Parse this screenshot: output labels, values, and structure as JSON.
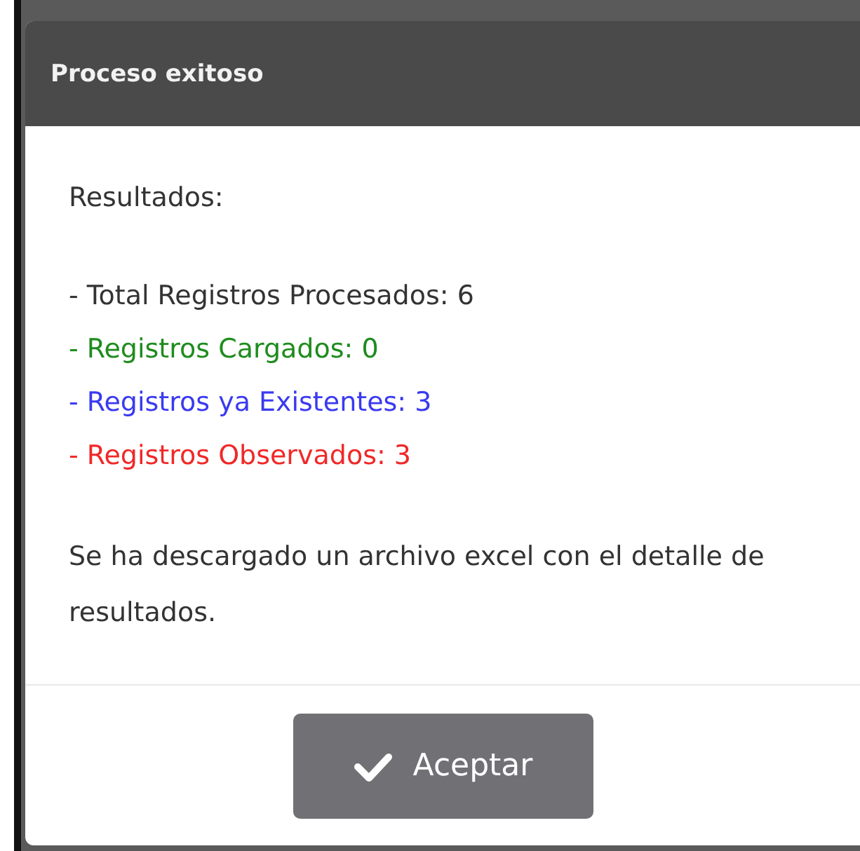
{
  "dialog": {
    "title": "Proceso exitoso",
    "heading": "Resultados:",
    "results": [
      {
        "text": "- Total Registros Procesados: 6",
        "color": "#333333"
      },
      {
        "text": "- Registros Cargados: 0",
        "color": "#1e8c1e"
      },
      {
        "text": "- Registros ya Existentes: 3",
        "color": "#3a3af0"
      },
      {
        "text": "- Registros Observados: 3",
        "color": "#f02828"
      }
    ],
    "message": "Se ha descargado un archivo excel con el detalle de resultados.",
    "button": "Aceptar"
  }
}
